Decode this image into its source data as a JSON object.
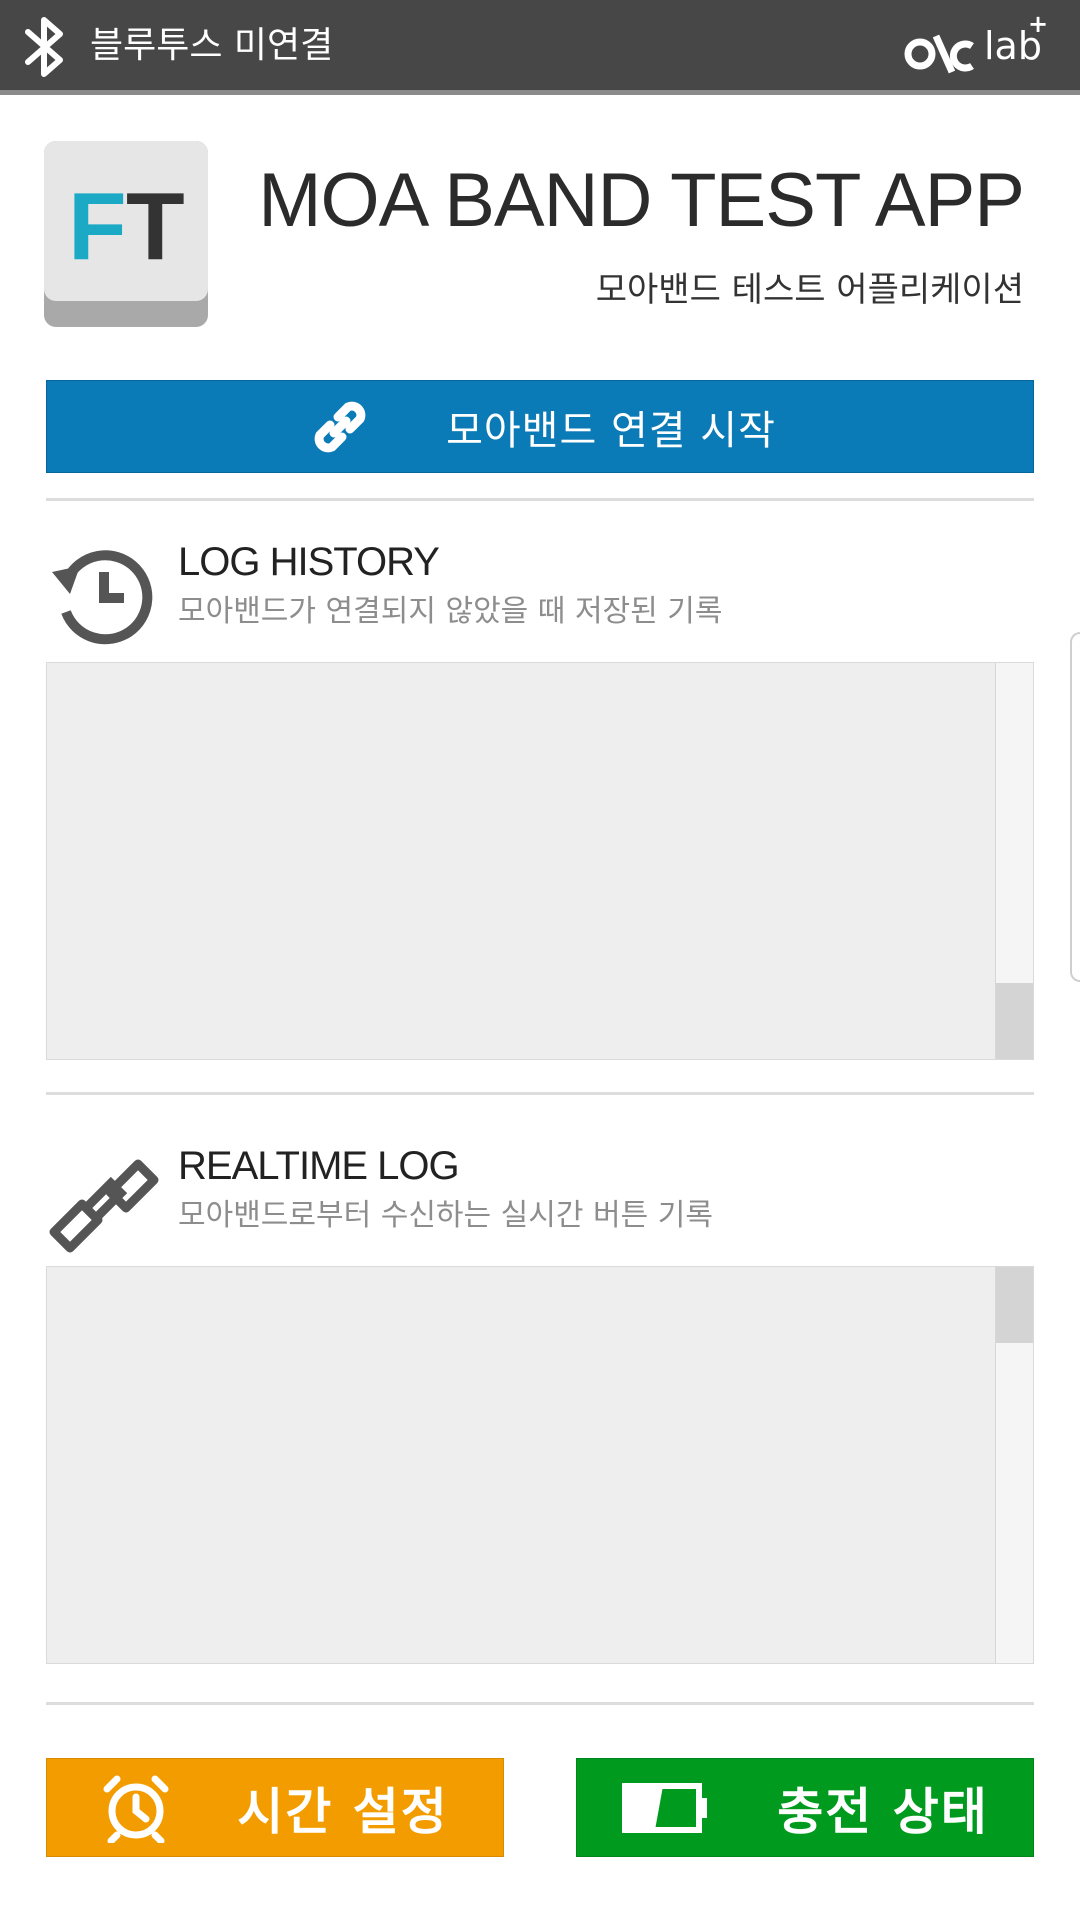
{
  "status_bar": {
    "bluetooth_icon": "bluetooth-icon",
    "bluetooth_status": "블루투스 미연결",
    "brand_text": "lab",
    "brand_plus": "+"
  },
  "header": {
    "icon_letter_f": "F",
    "icon_letter_t": "T",
    "title": "MOA BAND TEST APP",
    "subtitle": "모아밴드 테스트 어플리케이션"
  },
  "connect_button": {
    "label": "모아밴드 연결 시작",
    "icon": "link-icon",
    "color": "#0a7bb6"
  },
  "log_history": {
    "icon": "history-icon",
    "title": "LOG HISTORY",
    "description": "모아밴드가 연결되지 않았을 때 저장된 기록"
  },
  "realtime_log": {
    "icon": "chain-icon",
    "title": "REALTIME LOG",
    "description": "모아밴드로부터 수신하는 실시간 버튼 기록"
  },
  "buttons": {
    "time_setting": {
      "label": "시간 설정",
      "icon": "alarm-clock-icon",
      "color": "#f39c00"
    },
    "charge_status": {
      "label": "충전 상태",
      "icon": "battery-icon",
      "color": "#009b1e"
    }
  }
}
